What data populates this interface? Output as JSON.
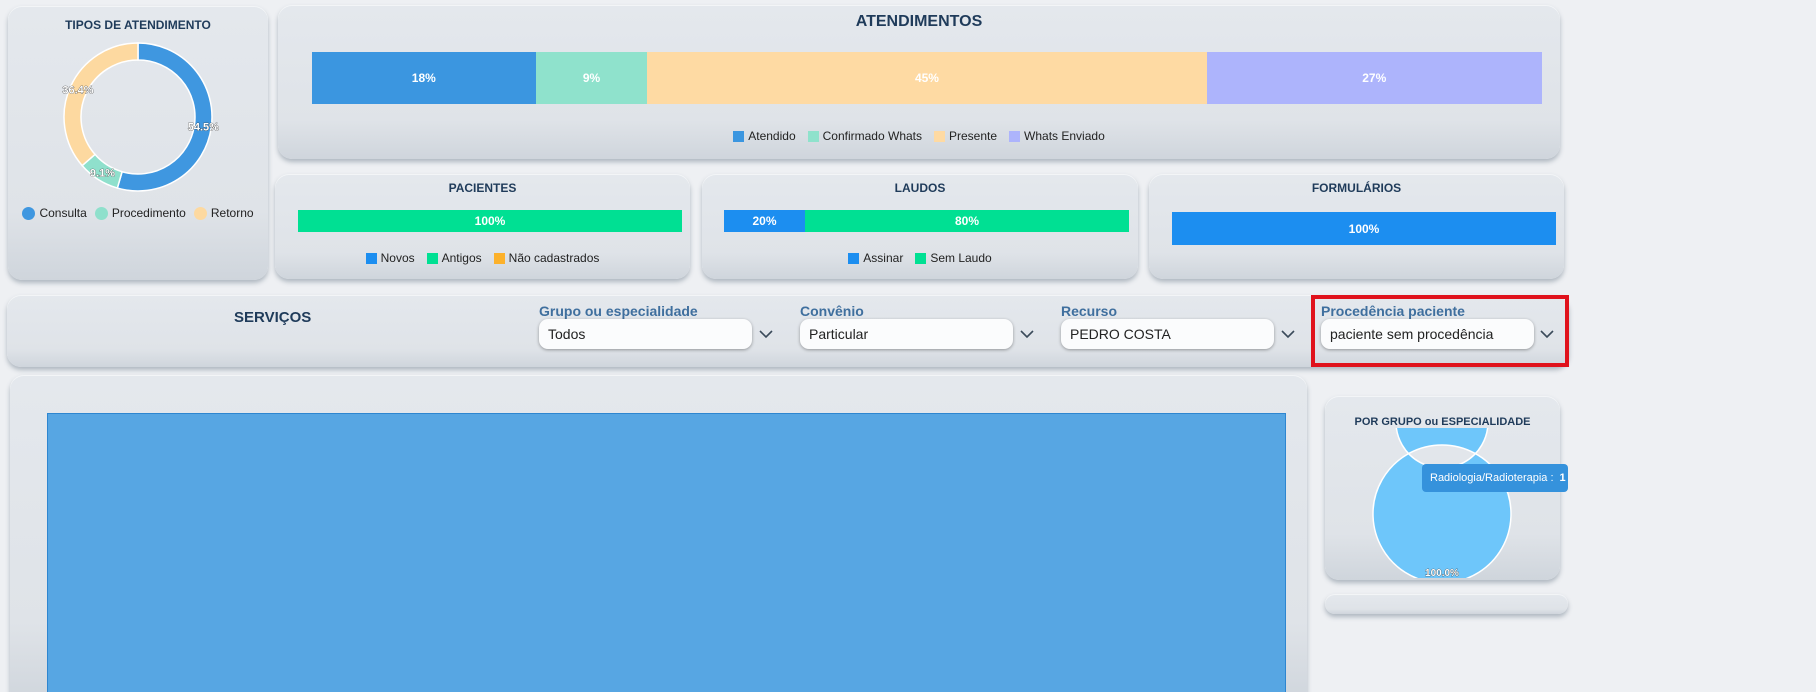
{
  "tipos": {
    "title": "TIPOS DE ATENDIMENTO",
    "chart_data": {
      "type": "pie",
      "labels": [
        "Consulta",
        "Procedimento",
        "Retorno"
      ],
      "values": [
        54.5,
        9.1,
        36.4
      ],
      "value_labels": [
        "54.5%",
        "9.1%",
        "36.4%"
      ],
      "colors": [
        "#3f97e0",
        "#8fe0cc",
        "#fdd9a0"
      ],
      "donut": true,
      "legend_position": "bottom"
    }
  },
  "atendimentos": {
    "title": "ATENDIMENTOS",
    "chart_data": {
      "type": "bar",
      "stacked": true,
      "orientation": "horizontal",
      "normalized": "percent",
      "series": [
        {
          "name": "Atendido",
          "value": 18,
          "label": "18%",
          "color": "#3b96e0"
        },
        {
          "name": "Confirmado Whats",
          "value": 9,
          "label": "9%",
          "color": "#8fe2cc"
        },
        {
          "name": "Presente",
          "value": 45,
          "label": "45%",
          "color": "#fedaa3"
        },
        {
          "name": "Whats Enviado",
          "value": 27,
          "label": "27%",
          "color": "#adb4fc"
        }
      ],
      "legend_position": "bottom"
    }
  },
  "pacientes": {
    "title": "PACIENTES",
    "chart_data": {
      "type": "bar",
      "stacked": true,
      "orientation": "horizontal",
      "normalized": "percent",
      "series": [
        {
          "name": "Novos",
          "value": 0,
          "label": "",
          "color": "#1c8ef0"
        },
        {
          "name": "Antigos",
          "value": 100,
          "label": "100%",
          "color": "#00e093"
        },
        {
          "name": "Não cadastrados",
          "value": 0,
          "label": "",
          "color": "#fcb12b"
        }
      ],
      "legend_position": "bottom"
    }
  },
  "laudos": {
    "title": "LAUDOS",
    "chart_data": {
      "type": "bar",
      "stacked": true,
      "orientation": "horizontal",
      "normalized": "percent",
      "series": [
        {
          "name": "Assinar",
          "value": 20,
          "label": "20%",
          "color": "#1c8ef0"
        },
        {
          "name": "Sem Laudo",
          "value": 80,
          "label": "80%",
          "color": "#00e093"
        }
      ],
      "legend_position": "bottom"
    }
  },
  "formularios": {
    "title": "FORMULÁRIOS",
    "chart_data": {
      "type": "bar",
      "stacked": true,
      "orientation": "horizontal",
      "normalized": "percent",
      "series": [
        {
          "name": "",
          "value": 100,
          "label": "100%",
          "color": "#1c8ef0"
        }
      ]
    }
  },
  "servicos": {
    "title": "SERVIÇOS",
    "filters": [
      {
        "label": "Grupo ou especialidade",
        "value": "Todos"
      },
      {
        "label": "Convênio",
        "value": "Particular"
      },
      {
        "label": "Recurso",
        "value": "PEDRO COSTA"
      },
      {
        "label": "Procedência paciente",
        "value": "paciente sem procedência"
      }
    ],
    "highlight_color": "#e0121c"
  },
  "main_chart": {
    "chart_data": {
      "type": "bar",
      "categories": [],
      "series": [
        {
          "values": [
            1
          ]
        }
      ],
      "color": "#57a6e3"
    }
  },
  "por_grupo": {
    "title": "POR GRUPO ou ESPECIALIDADE",
    "chart_data": {
      "type": "pie",
      "donut": true,
      "labels": [
        "Radiologia/Radioterapia"
      ],
      "values": [
        1
      ],
      "value_labels": [
        "100.0%"
      ],
      "colors": [
        "#6ec6fa"
      ]
    },
    "tooltip": {
      "label": "Radiologia/Radioterapia :",
      "value": "1"
    }
  }
}
